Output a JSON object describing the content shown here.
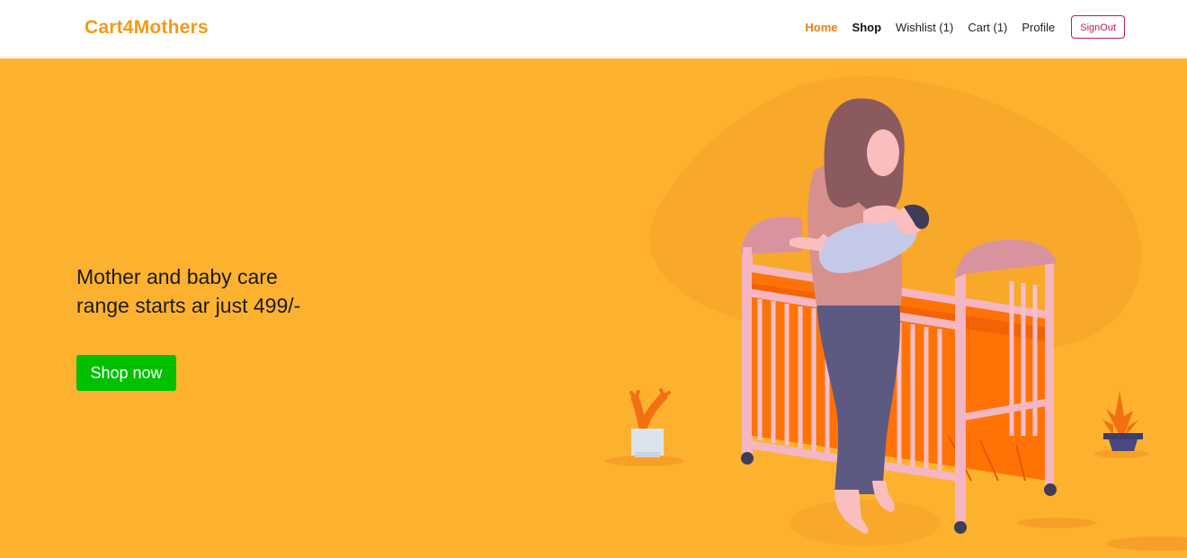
{
  "brand": "Cart4Mothers",
  "nav": {
    "home": "Home",
    "shop": "Shop",
    "wishlist": "Wishlist (1)",
    "cart": "Cart (1)",
    "profile": "Profile",
    "signout": "SignOut"
  },
  "hero": {
    "headline": "Mother and baby care range starts ar just 499/-",
    "button": "Shop now"
  },
  "colors": {
    "brand": "#f39a12",
    "hero_bg": "#fdb22f",
    "shop_button": "#00c000",
    "signout_border": "#c2185b"
  }
}
